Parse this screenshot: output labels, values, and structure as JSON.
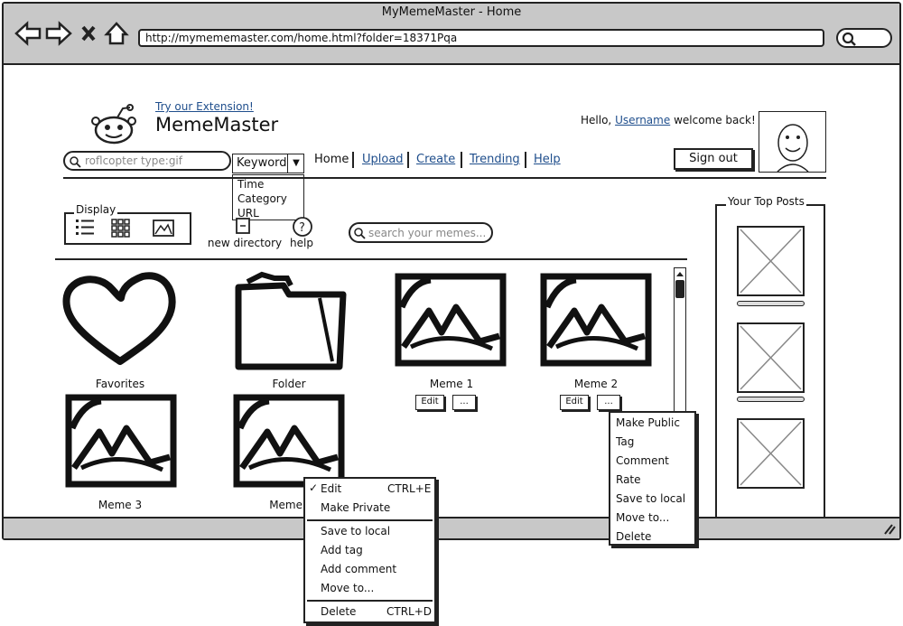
{
  "window": {
    "title": "MyMemeMaster - Home",
    "url": "http://mymememaster.com/home.html?folder=18371Pqa"
  },
  "header": {
    "extension_link": "Try our Extension!",
    "brand": "MemeMaster",
    "hello_prefix": "Hello,",
    "username": "Username",
    "hello_suffix": "welcome back!",
    "sign_out": "Sign out"
  },
  "search": {
    "value": "roflcopter type:gif",
    "filter_selected": "Keyword",
    "filter_options": [
      "Time",
      "Category",
      "URL"
    ]
  },
  "nav": {
    "items": [
      "Home",
      "Upload",
      "Create",
      "Trending",
      "Help"
    ]
  },
  "toolbar": {
    "display_label": "Display",
    "new_directory": "new directory",
    "help": "help",
    "search_memes_placeholder": "search your memes..."
  },
  "items": [
    {
      "label": "Favorites",
      "icon": "heart-icon"
    },
    {
      "label": "Folder",
      "icon": "folder-icon"
    },
    {
      "label": "Meme 1",
      "icon": "image-icon"
    },
    {
      "label": "Meme 2",
      "icon": "image-icon"
    },
    {
      "label": "Meme 3",
      "icon": "image-icon"
    },
    {
      "label": "Meme",
      "icon": "image-icon"
    }
  ],
  "item_buttons": {
    "edit": "Edit",
    "more": "..."
  },
  "top_posts": {
    "label": "Your Top Posts"
  },
  "context_menu_1": {
    "items": [
      {
        "label": "Edit",
        "shortcut": "CTRL+E",
        "checked": true
      },
      {
        "label": "Make Private"
      },
      {
        "label": "Save to local"
      },
      {
        "label": "Add tag"
      },
      {
        "label": "Add comment"
      },
      {
        "label": "Move to..."
      },
      {
        "label": "Delete",
        "shortcut": "CTRL+D"
      }
    ]
  },
  "context_menu_2": {
    "items": [
      "Make Public",
      "Tag",
      "Comment",
      "Rate",
      "Save to local",
      "Move to...",
      "Delete"
    ]
  }
}
